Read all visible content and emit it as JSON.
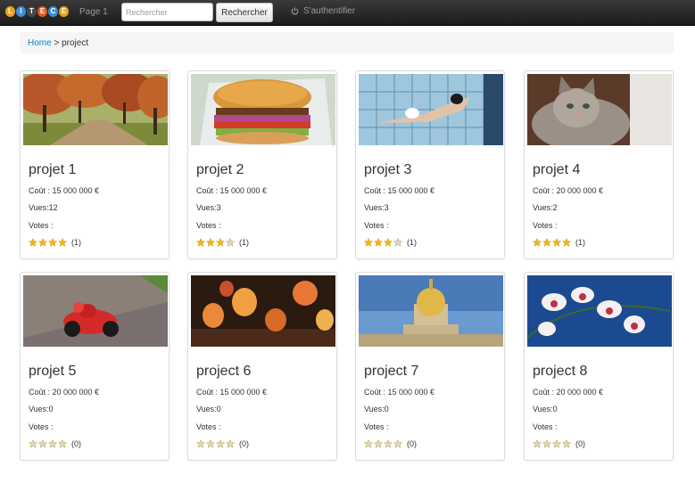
{
  "navbar": {
    "logo_letters": [
      "L",
      "I",
      "T",
      "E",
      "C",
      "E"
    ],
    "logo_colors": [
      "#e8a31c",
      "#3b8fd8",
      "#4a4a4a",
      "#e85a1c",
      "#3b8fd8",
      "#e8a31c"
    ],
    "page_link": "Page 1",
    "search": {
      "placeholder": "Rechercher",
      "value": ""
    },
    "search_button": "Rechercher",
    "auth_label": "S'authentifier"
  },
  "breadcrumb": {
    "home": "Home",
    "separator": " > ",
    "current": "project"
  },
  "colors": {
    "star_filled": "#f2b619",
    "star_empty": "#d6d6d6",
    "link": "#0088cc"
  },
  "projects": [
    {
      "title": "projet 1",
      "cost": "Coût : 15 000 000 €",
      "views": "Vues:12",
      "votes_label": "Votes :",
      "stars": 4,
      "count": "(1)",
      "image": "autumn-trees"
    },
    {
      "title": "projet 2",
      "cost": "Coût : 15 000 000 €",
      "views": "Vues:3",
      "votes_label": "Votes :",
      "stars": 3,
      "count": "(1)",
      "image": "burger"
    },
    {
      "title": "projet 3",
      "cost": "Coût : 15 000 000 €",
      "views": "Vues:3",
      "votes_label": "Votes :",
      "stars": 3,
      "count": "(1)",
      "image": "swimmer"
    },
    {
      "title": "projet 4",
      "cost": "Coût : 20 000 000 €",
      "views": "Vues:2",
      "votes_label": "Votes :",
      "stars": 4,
      "count": "(1)",
      "image": "cat"
    },
    {
      "title": "projet 5",
      "cost": "Coût : 20 000 000 €",
      "views": "Vues:0",
      "votes_label": "Votes :",
      "stars": 0,
      "count": "(0)",
      "image": "motorcycle"
    },
    {
      "title": "project 6",
      "cost": "Coût : 15 000 000 €",
      "views": "Vues:0",
      "votes_label": "Votes :",
      "stars": 0,
      "count": "(0)",
      "image": "lanterns"
    },
    {
      "title": "project 7",
      "cost": "Coût : 15 000 000 €",
      "views": "Vues:0",
      "votes_label": "Votes :",
      "stars": 0,
      "count": "(0)",
      "image": "invalides-dome"
    },
    {
      "title": "project 8",
      "cost": "Coût : 20 000 000 €",
      "views": "Vues:0",
      "votes_label": "Votes :",
      "stars": 0,
      "count": "(0)",
      "image": "orchid"
    }
  ]
}
